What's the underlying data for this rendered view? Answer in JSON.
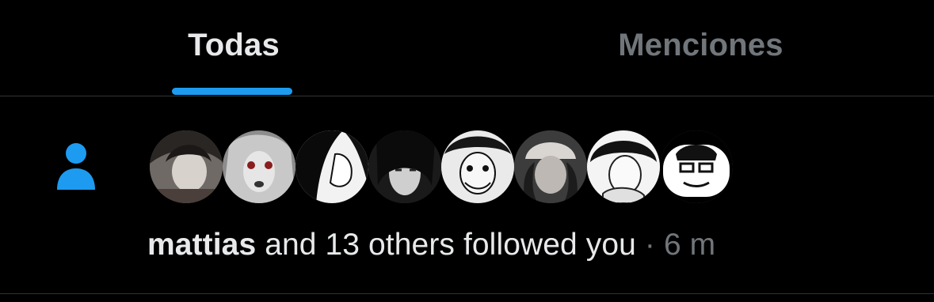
{
  "tabs": [
    {
      "label": "Todas",
      "selected": true
    },
    {
      "label": "Menciones",
      "selected": false
    }
  ],
  "colors": {
    "accent": "#1d9bf0",
    "text_primary": "#e7e9ea",
    "text_secondary": "#71767b",
    "background": "#000000"
  },
  "notification": {
    "type_icon": "person-icon",
    "avatar_icons": [
      "avatar-1",
      "avatar-2",
      "avatar-3",
      "avatar-4",
      "avatar-5",
      "avatar-6",
      "avatar-7",
      "avatar-8"
    ],
    "user_name": "mattias",
    "action_text": " and 13 others followed you",
    "separator": " · ",
    "time": "6 m"
  }
}
